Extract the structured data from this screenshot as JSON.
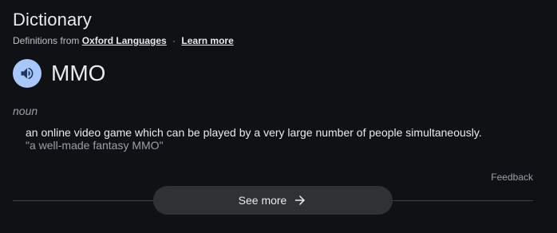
{
  "header": {
    "title": "Dictionary",
    "source_prefix": "Definitions from",
    "source_link": "Oxford Languages",
    "separator": "·",
    "learn_more": "Learn more"
  },
  "entry": {
    "speaker_icon": "volume-up-icon",
    "word": "MMO",
    "part_of_speech": "noun",
    "definition": "an online video game which can be played by a very large number of people simultaneously.",
    "example": "\"a well-made fantasy MMO\""
  },
  "footer": {
    "feedback": "Feedback",
    "see_more_label": "See more",
    "see_more_icon": "arrow-right-icon"
  },
  "colors": {
    "background": "#0f1115",
    "speaker_button": "#a8c7fa",
    "button_bg": "#303134",
    "text_primary": "#e8eaed",
    "text_secondary": "#9aa0a6"
  }
}
